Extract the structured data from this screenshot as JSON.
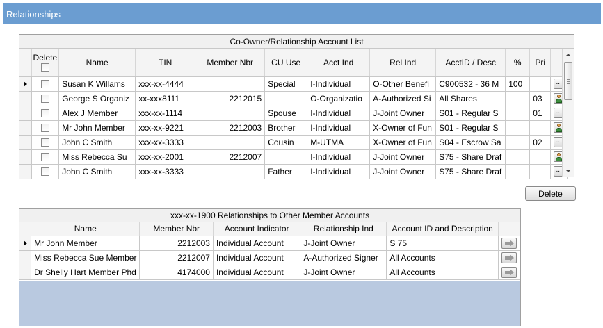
{
  "window": {
    "title": "Relationships"
  },
  "coowner_grid": {
    "caption": "Co-Owner/Relationship Account List",
    "columns": {
      "delete": "Delete",
      "name": "Name",
      "tin": "TIN",
      "member_nbr": "Member Nbr",
      "cu_use": "CU Use",
      "acct_ind": "Acct Ind",
      "rel_ind": "Rel Ind",
      "acct_desc": "AcctID / Desc",
      "pct": "%",
      "pri": "Pri"
    },
    "rows": [
      {
        "name": "Susan K Willams",
        "tin": "xxx-xx-4444",
        "member_nbr": "",
        "cu_use": "Special",
        "acct_ind": "I-Individual",
        "rel_ind": "O-Other Benefi",
        "acct_desc": "C900532 - 36 M",
        "pct": "100",
        "pri": "",
        "action": "ellipsis",
        "selected": true
      },
      {
        "name": "George S Organiz",
        "tin": "xx-xxx8111",
        "member_nbr": "2212015",
        "cu_use": "",
        "acct_ind": "O-Organizatio",
        "rel_ind": "A-Authorized Si",
        "acct_desc": "All Shares",
        "pct": "",
        "pri": "03",
        "action": "person",
        "selected": false
      },
      {
        "name": "Alex J Member",
        "tin": "xxx-xx-1114",
        "member_nbr": "",
        "cu_use": "Spouse",
        "acct_ind": "I-Individual",
        "rel_ind": "J-Joint Owner",
        "acct_desc": "S01 - Regular S",
        "pct": "",
        "pri": "01",
        "action": "ellipsis",
        "selected": false
      },
      {
        "name": "Mr John Member",
        "tin": "xxx-xx-9221",
        "member_nbr": "2212003",
        "cu_use": "Brother",
        "acct_ind": "I-Individual",
        "rel_ind": "X-Owner of Fun",
        "acct_desc": "S01 - Regular S",
        "pct": "",
        "pri": "",
        "action": "person",
        "selected": false
      },
      {
        "name": "John C Smith",
        "tin": "xxx-xx-3333",
        "member_nbr": "",
        "cu_use": "Cousin",
        "acct_ind": "M-UTMA",
        "rel_ind": "X-Owner of Fun",
        "acct_desc": "S04 - Escrow Sa",
        "pct": "",
        "pri": "02",
        "action": "ellipsis",
        "selected": false
      },
      {
        "name": "Miss Rebecca Su",
        "tin": "xxx-xx-2001",
        "member_nbr": "2212007",
        "cu_use": "",
        "acct_ind": "I-Individual",
        "rel_ind": "J-Joint Owner",
        "acct_desc": "S75 - Share Draf",
        "pct": "",
        "pri": "",
        "action": "person",
        "selected": false
      },
      {
        "name": "John C Smith",
        "tin": "xxx-xx-3333",
        "member_nbr": "",
        "cu_use": "Father",
        "acct_ind": "I-Individual",
        "rel_ind": "J-Joint Owner",
        "acct_desc": "S75 - Share Draf",
        "pct": "",
        "pri": "",
        "action": "ellipsis",
        "selected": false
      }
    ],
    "ellipsis_label": "..."
  },
  "delete_button": {
    "label": "Delete"
  },
  "other_accounts_grid": {
    "caption": "xxx-xx-1900 Relationships to Other Member Accounts",
    "columns": {
      "name": "Name",
      "member_nbr": "Member Nbr",
      "account_indicator": "Account Indicator",
      "relationship_ind": "Relationship Ind",
      "account_desc": "Account ID and Description"
    },
    "rows": [
      {
        "name": "Mr John Member",
        "member_nbr": "2212003",
        "account_indicator": "Individual Account",
        "relationship_ind": "J-Joint Owner",
        "account_desc": "S 75",
        "selected": true
      },
      {
        "name": "Miss Rebecca Sue Member",
        "member_nbr": "2212007",
        "account_indicator": "Individual Account",
        "relationship_ind": "A-Authorized Signer",
        "account_desc": "All Accounts",
        "selected": false
      },
      {
        "name": "Dr Shelly Hart Member Phd",
        "member_nbr": "4174000",
        "account_indicator": "Individual Account",
        "relationship_ind": "J-Joint Owner",
        "account_desc": "All Accounts",
        "selected": false
      }
    ]
  },
  "colors": {
    "title_bar": "#6b9dd1",
    "grid_empty_area": "#b9c9e0",
    "header_background": "#f4f4f4"
  },
  "icons": {
    "row_selector": "row-indicator-icon",
    "ellipsis": "ellipsis-icon",
    "person": "person-icon",
    "navigate": "arrow-right-icon"
  }
}
